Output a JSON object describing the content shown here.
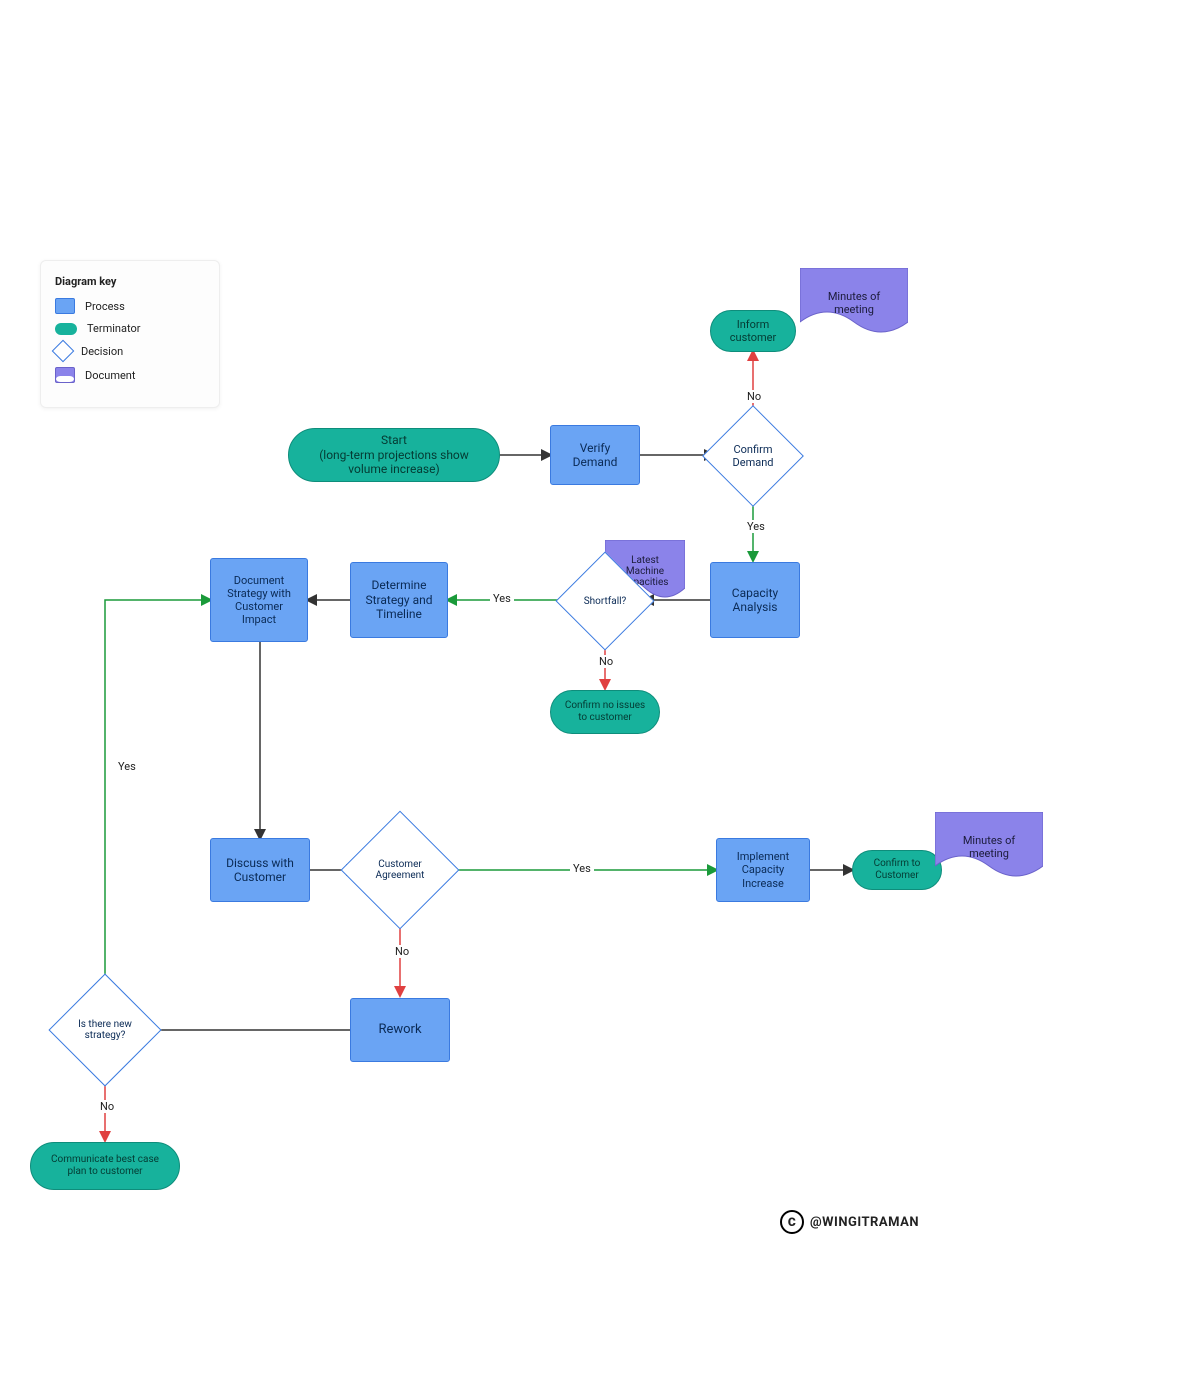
{
  "legend": {
    "title": "Diagram key",
    "items": [
      {
        "label": "Process"
      },
      {
        "label": "Terminator"
      },
      {
        "label": "Decision"
      },
      {
        "label": "Document"
      }
    ]
  },
  "colors": {
    "process": "#6aa4f4",
    "terminator": "#17b29c",
    "decisionBorder": "#3a7ae0",
    "document": "#8b83ea",
    "arrowYes": "#1a9a3a",
    "arrowNo": "#e04040",
    "arrowNeutral": "#333333"
  },
  "credit": {
    "symbol": "C",
    "handle": "@WINGITRAMAN"
  },
  "nodes": {
    "start": {
      "text": "Start\n(long-term projections show\nvolume increase)"
    },
    "verifyDemand": {
      "text": "Verify\nDemand"
    },
    "confirmDemand": {
      "text": "Confirm\nDemand"
    },
    "informCustomer": {
      "text": "Inform\ncustomer"
    },
    "minutes1": {
      "text": "Minutes of\nmeeting"
    },
    "capacityAnalysis": {
      "text": "Capacity\nAnalysis"
    },
    "latestMachine": {
      "text": "Latest\nMachine\nCapacities"
    },
    "shortfall": {
      "text": "Shortfall?"
    },
    "confirmNoIssues": {
      "text": "Confirm no issues\nto customer"
    },
    "determineStrategy": {
      "text": "Determine\nStrategy and\nTimeline"
    },
    "documentStrategy": {
      "text": "Document\nStrategy with\nCustomer\nImpact"
    },
    "discussCustomer": {
      "text": "Discuss with\nCustomer"
    },
    "customerAgreement": {
      "text": "Customer\nAgreement"
    },
    "implementCapacity": {
      "text": "Implement\nCapacity\nIncrease"
    },
    "confirmToCustomer": {
      "text": "Confirm to\nCustomer"
    },
    "minutes2": {
      "text": "Minutes of\nmeeting"
    },
    "rework": {
      "text": "Rework"
    },
    "newStrategy": {
      "text": "Is there new\nstrategy?"
    },
    "communicateBest": {
      "text": "Communicate best case\nplan to customer"
    }
  },
  "edges": {
    "startToVerify": null,
    "verifyToConfirm": null,
    "confirmNo": "No",
    "confirmYes": "Yes",
    "capacityToShortfall": null,
    "shortfallNo": "No",
    "shortfallYes": "Yes",
    "determineToDocument": null,
    "documentToDiscuss": null,
    "discussToAgreement": null,
    "agreementYes": "Yes",
    "agreementNo": "No",
    "reworkToNewStrategy": null,
    "newStrategyYes": "Yes",
    "newStrategyNo": "No",
    "implementToConfirm": null
  }
}
